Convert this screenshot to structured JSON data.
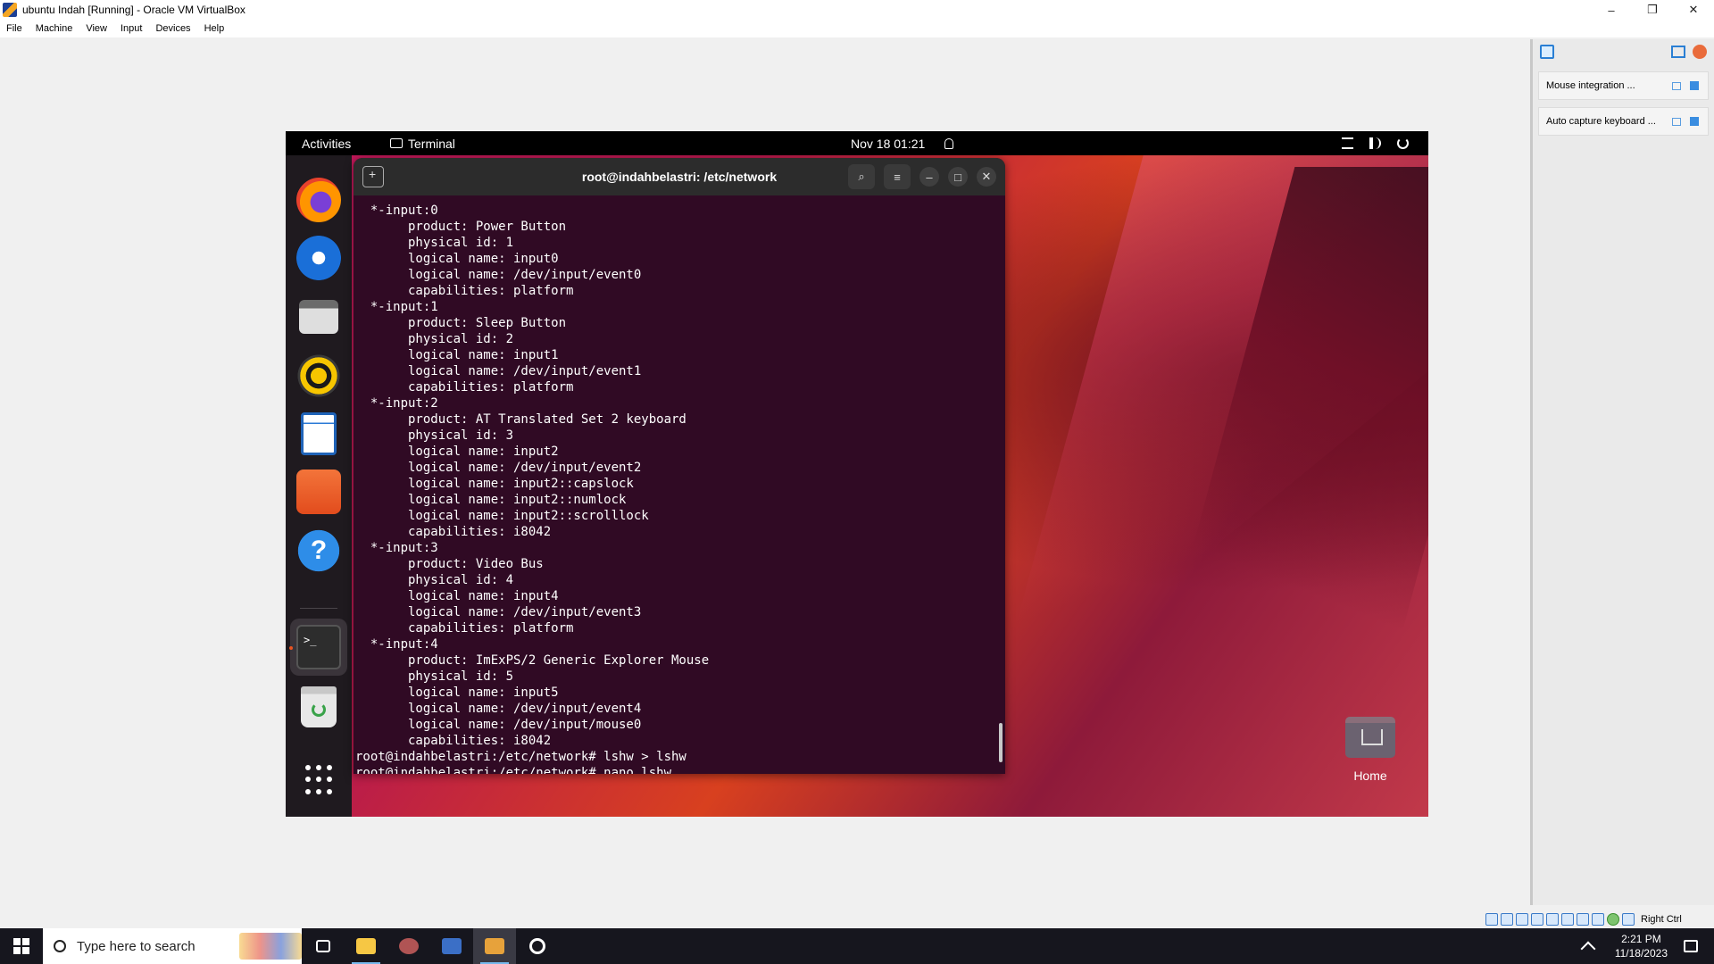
{
  "window": {
    "title": "ubuntu Indah [Running] - Oracle VM VirtualBox",
    "controls": [
      "–",
      "❐",
      "✕"
    ]
  },
  "menu": [
    "File",
    "Machine",
    "View",
    "Input",
    "Devices",
    "Help"
  ],
  "notifications": [
    {
      "text": "Mouse integration ..."
    },
    {
      "text": "Auto capture keyboard ..."
    }
  ],
  "status_bar": {
    "host_key": "Right Ctrl"
  },
  "gnome": {
    "activities": "Activities",
    "app_name": "Terminal",
    "clock": "Nov 18  01:21"
  },
  "dock": {
    "apps": [
      "firefox-icon",
      "thunderbird-icon",
      "files-icon",
      "rhythmbox-icon",
      "libreoffice-writer-icon",
      "app-store-icon",
      "help-icon",
      "terminal-icon",
      "trash-icon",
      "show-apps-icon"
    ],
    "help_glyph": "?",
    "terminal_glyph": ">_"
  },
  "desktop": {
    "home_label": "Home"
  },
  "terminal": {
    "title": "root@indahbelastri: /etc/network",
    "buttons": {
      "search": "⌕",
      "menu": "≡",
      "minimize": "–",
      "maximize": "□",
      "close": "✕"
    },
    "lines": [
      "  *-input:0",
      "       product: Power Button",
      "       physical id: 1",
      "       logical name: input0",
      "       logical name: /dev/input/event0",
      "       capabilities: platform",
      "  *-input:1",
      "       product: Sleep Button",
      "       physical id: 2",
      "       logical name: input1",
      "       logical name: /dev/input/event1",
      "       capabilities: platform",
      "  *-input:2",
      "       product: AT Translated Set 2 keyboard",
      "       physical id: 3",
      "       logical name: input2",
      "       logical name: /dev/input/event2",
      "       logical name: input2::capslock",
      "       logical name: input2::numlock",
      "       logical name: input2::scrolllock",
      "       capabilities: i8042",
      "  *-input:3",
      "       product: Video Bus",
      "       physical id: 4",
      "       logical name: input4",
      "       logical name: /dev/input/event3",
      "       capabilities: platform",
      "  *-input:4",
      "       product: ImExPS/2 Generic Explorer Mouse",
      "       physical id: 5",
      "       logical name: input5",
      "       logical name: /dev/input/event4",
      "       logical name: /dev/input/mouse0",
      "       capabilities: i8042",
      "root@indahbelastri:/etc/network# lshw > lshw",
      "root@indahbelastri:/etc/network# nano lshw"
    ]
  },
  "taskbar": {
    "search_placeholder": "Type here to search",
    "time": "2:21 PM",
    "date": "11/18/2023"
  }
}
